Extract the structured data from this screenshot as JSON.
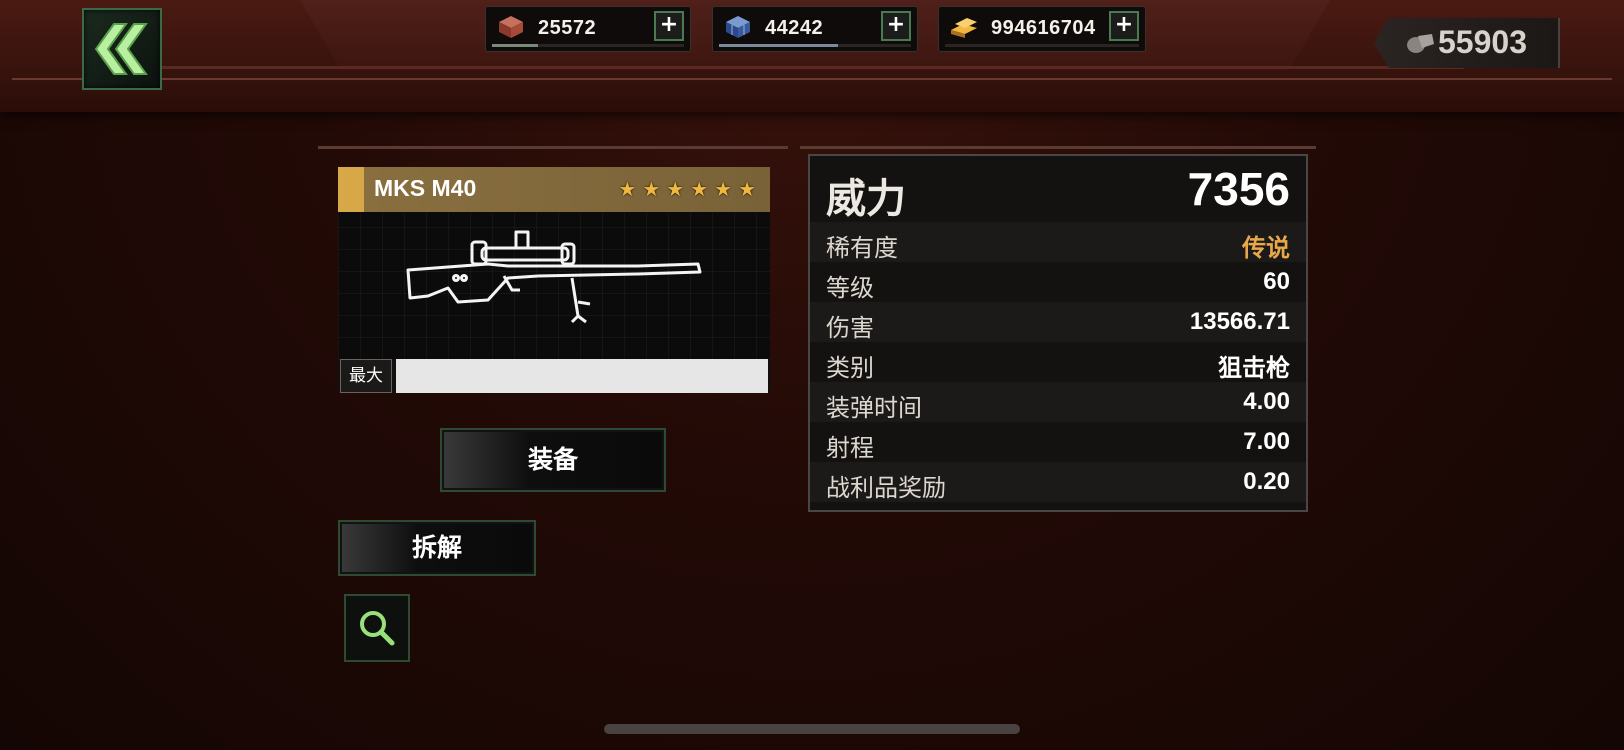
{
  "resources": [
    {
      "icon": "brick-icon",
      "value": "25572",
      "fill": 0.24,
      "color": "#7a8a7a"
    },
    {
      "icon": "crate-icon",
      "value": "44242",
      "fill": 0.62,
      "color": "#7a8a9a"
    },
    {
      "icon": "gold-bar-icon",
      "value": "994616704",
      "fill": 0.0,
      "color": "#7a8a7a"
    }
  ],
  "currency": {
    "icon": "bullet-icon",
    "value": "55903"
  },
  "weapon": {
    "name": "MKS M40",
    "stars": 6,
    "image_icon": "sniper-rifle-icon",
    "max_label": "最大",
    "level_fill": 1.0
  },
  "buttons": {
    "equip": "装备",
    "dismantle": "拆解",
    "search_icon": "magnifier-icon",
    "back_icon": "double-chevron-left-icon"
  },
  "stats": {
    "power": {
      "label": "威力",
      "value": "7356"
    },
    "rows": [
      {
        "label": "稀有度",
        "value": "传说",
        "color": "#e8a84a"
      },
      {
        "label": "等级",
        "value": "60"
      },
      {
        "label": "伤害",
        "value": "13566.71"
      },
      {
        "label": "类别",
        "value": "狙击枪"
      },
      {
        "label": "装弹时间",
        "value": "4.00"
      },
      {
        "label": "射程",
        "value": "7.00"
      },
      {
        "label": "战利品奖励",
        "value": "0.20"
      }
    ]
  }
}
